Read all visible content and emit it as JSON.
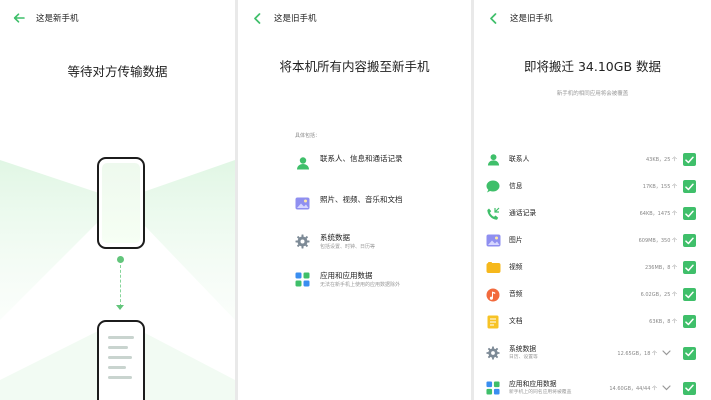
{
  "panel1": {
    "title": "这是新手机",
    "heading": "等待对方传输数据"
  },
  "panel2": {
    "title": "这是旧手机",
    "heading": "将本机所有内容搬至新手机",
    "contains_label": "具体包括：",
    "items": [
      {
        "icon": "contacts-icon",
        "title": "联系人、信息和通话记录",
        "sub": ""
      },
      {
        "icon": "photo-icon",
        "title": "照片、视频、音乐和文档",
        "sub": ""
      },
      {
        "icon": "settings-gear-icon",
        "title": "系统数据",
        "sub": "包括设置、时钟、日历等"
      },
      {
        "icon": "apps-grid-icon",
        "title": "应用和应用数据",
        "sub": "无法在新手机上使用的应用数据除外"
      }
    ]
  },
  "panel3": {
    "title": "这是旧手机",
    "heading": "即将搬迁 34.10GB 数据",
    "subheading": "新手机的相同应用将会被覆盖",
    "items": [
      {
        "icon": "contacts-icon",
        "label": "联系人",
        "sub": "",
        "size": "43KB，25 个",
        "expandable": false,
        "checked": true
      },
      {
        "icon": "message-icon",
        "label": "信息",
        "sub": "",
        "size": "17KB，155 个",
        "expandable": false,
        "checked": true
      },
      {
        "icon": "call-log-icon",
        "label": "通话记录",
        "sub": "",
        "size": "64KB，1475 个",
        "expandable": false,
        "checked": true
      },
      {
        "icon": "image-icon",
        "label": "图片",
        "sub": "",
        "size": "609MB，350 个",
        "expandable": false,
        "checked": true
      },
      {
        "icon": "video-icon",
        "label": "视频",
        "sub": "",
        "size": "236MB，8 个",
        "expandable": false,
        "checked": true
      },
      {
        "icon": "music-icon",
        "label": "音频",
        "sub": "",
        "size": "6.02GB，25 个",
        "expandable": false,
        "checked": true
      },
      {
        "icon": "document-icon",
        "label": "文档",
        "sub": "",
        "size": "63KB，8 个",
        "expandable": false,
        "checked": true
      },
      {
        "icon": "settings-gear-icon",
        "label": "系统数据",
        "sub": "日历、设置等",
        "size": "12.65GB，18 个",
        "expandable": true,
        "checked": true
      },
      {
        "icon": "apps-grid-icon",
        "label": "应用和应用数据",
        "sub": "新手机上的同名应用将被覆盖",
        "size": "14.60GB，44/44 个",
        "expandable": true,
        "checked": true
      }
    ]
  },
  "colors": {
    "accent": "#3fbf6a",
    "beam": "#e3f7e6"
  }
}
